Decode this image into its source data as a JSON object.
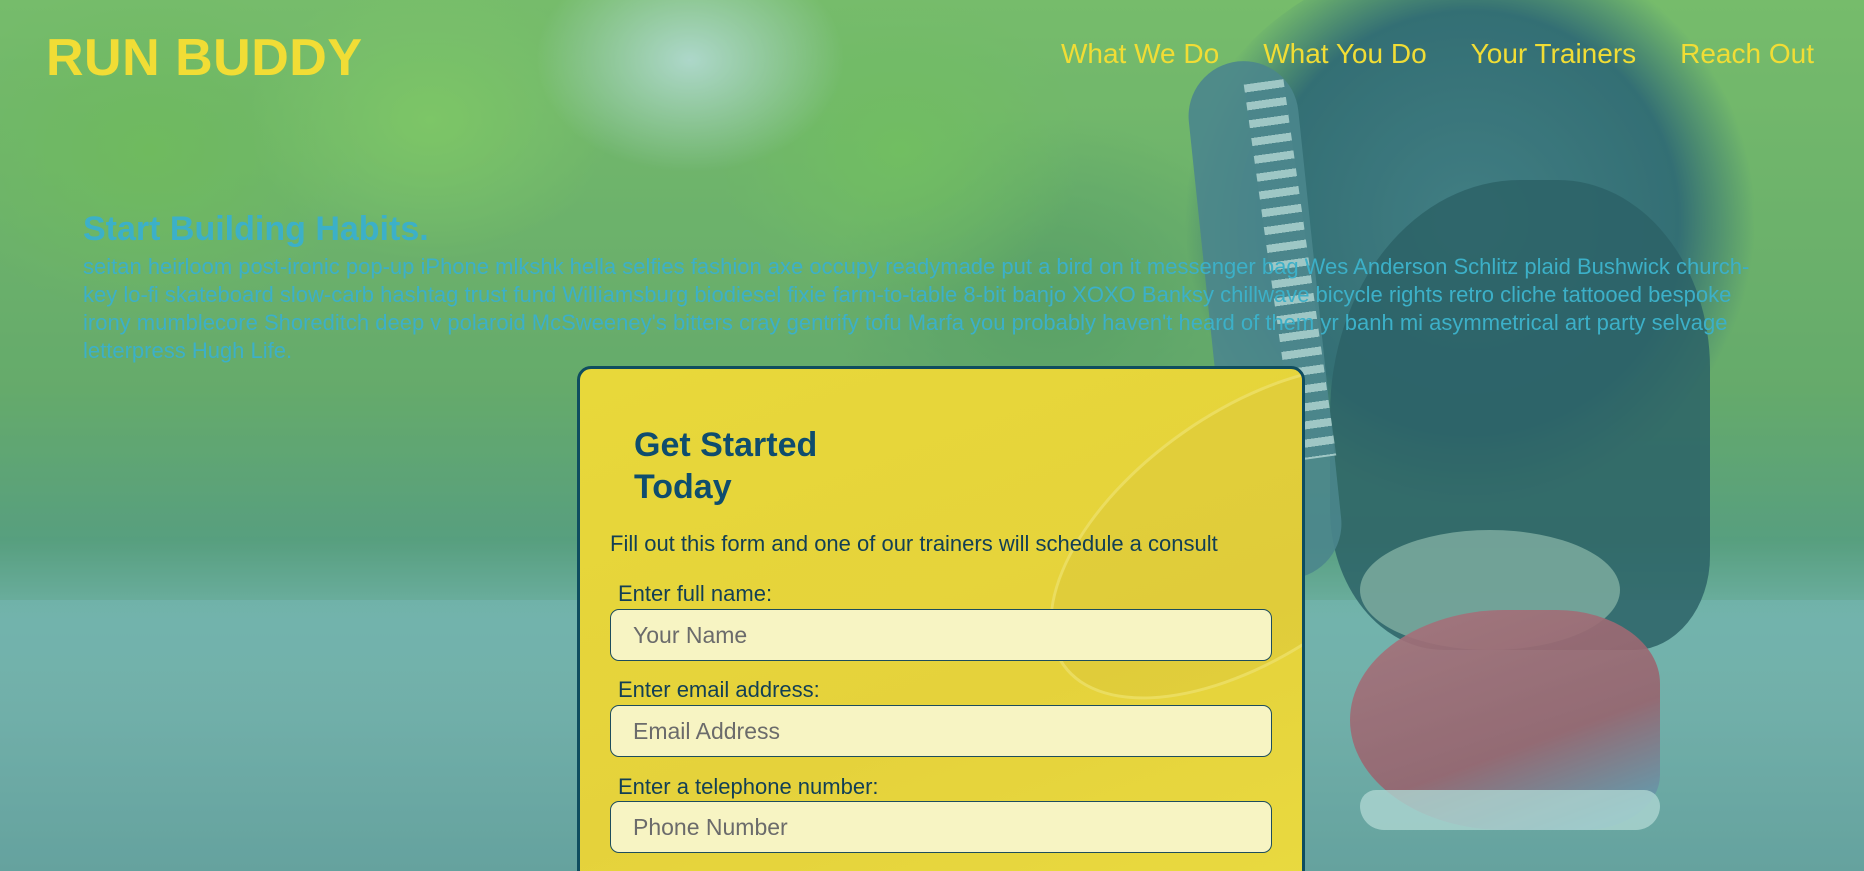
{
  "header": {
    "logo": "RUN BUDDY",
    "nav": [
      "What We Do",
      "What You Do",
      "Your Trainers",
      "Reach Out"
    ]
  },
  "intro": {
    "heading": "Start Building Habits.",
    "body": "seitan heirloom post-ironic pop-up iPhone mlkshk hella selfies fashion axe occupy readymade put a bird on it messenger bag Wes Anderson Schlitz plaid Bushwick church-key lo-fi skateboard slow-carb hashtag trust fund Williamsburg biodiesel fixie farm-to-table 8-bit banjo XOXO Banksy chillwave bicycle rights retro cliche tattooed bespoke irony mumblecore Shoreditch deep v polaroid McSweeney's bitters cray gentrify tofu Marfa you probably haven't heard of them yr banh mi asymmetrical art party selvage letterpress Hugh Life."
  },
  "form": {
    "title": "Get Started Today",
    "lead": "Fill out this form and one of our trainers will schedule a consult",
    "fields": [
      {
        "label": "Enter full name:",
        "placeholder": "Your Name",
        "value": ""
      },
      {
        "label": "Enter email address:",
        "placeholder": "Email Address",
        "value": ""
      },
      {
        "label": "Enter a telephone number:",
        "placeholder": "Phone Number",
        "value": ""
      }
    ]
  },
  "colors": {
    "accent_yellow": "#f1dd35",
    "intro_text": "#3cb0c8",
    "card_border": "#0f4d5f",
    "card_title": "#0f4d6e",
    "input_bg": "#f7f4c3"
  }
}
